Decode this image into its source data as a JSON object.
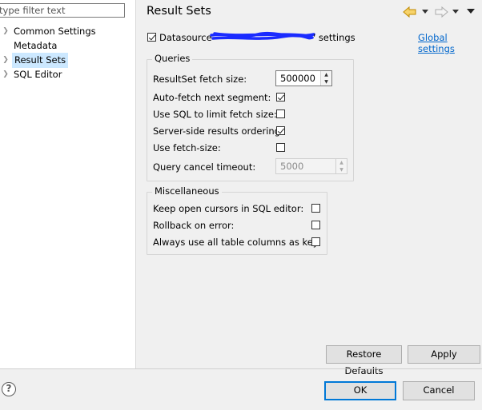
{
  "sidebar": {
    "filter_placeholder": "type filter text",
    "items": [
      {
        "label": "Common Settings",
        "expandable": true,
        "selected": false
      },
      {
        "label": "Metadata",
        "expandable": false,
        "selected": false
      },
      {
        "label": "Result Sets",
        "expandable": true,
        "selected": true
      },
      {
        "label": "SQL Editor",
        "expandable": true,
        "selected": false
      }
    ]
  },
  "header": {
    "title": "Result Sets",
    "icons": [
      "back-arrow-icon",
      "back-menu-icon",
      "forward-arrow-icon",
      "forward-menu-icon",
      "view-menu-icon"
    ]
  },
  "datasource": {
    "label_prefix": "Datasource",
    "label_suffix": "' settings",
    "checked": true,
    "global_link": "Global settings"
  },
  "queries": {
    "title": "Queries",
    "fetch_size_label": "ResultSet fetch size:",
    "fetch_size_value": "500000",
    "auto_fetch_label": "Auto-fetch next segment:",
    "auto_fetch_checked": true,
    "sql_limit_label": "Use SQL to limit fetch size:",
    "sql_limit_checked": false,
    "server_order_label": "Server-side results ordering:",
    "server_order_checked": true,
    "use_fetch_size_label": "Use fetch-size:",
    "use_fetch_size_checked": false,
    "cancel_timeout_label": "Query cancel timeout:",
    "cancel_timeout_value": "5000"
  },
  "misc": {
    "title": "Miscellaneous",
    "keep_cursors_label": "Keep open cursors in SQL editor:",
    "keep_cursors_checked": false,
    "rollback_label": "Rollback on error:",
    "rollback_checked": false,
    "all_columns_label": "Always use all table columns as key:",
    "all_columns_checked": false
  },
  "buttons": {
    "restore_defaults": "Restore Defaults",
    "apply": "Apply",
    "ok": "OK",
    "cancel": "Cancel"
  },
  "colors": {
    "selection": "#cce8ff",
    "link": "#0066cc",
    "default_button_border": "#0078d7",
    "nav_arrow": "#e0a000",
    "redaction": "#1a2bff"
  }
}
